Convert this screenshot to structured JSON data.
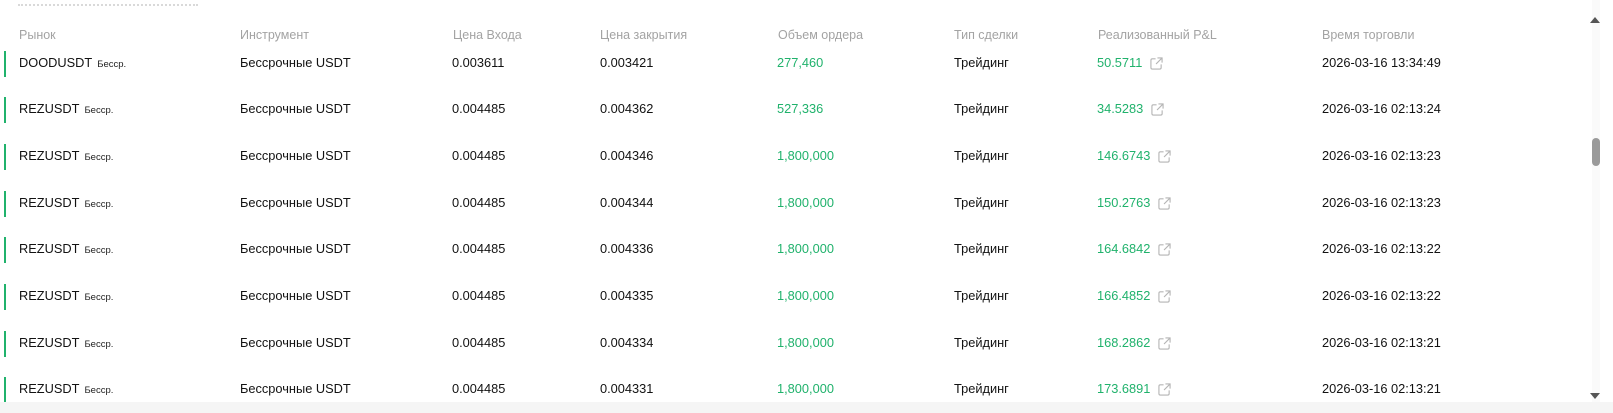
{
  "table": {
    "headers": {
      "market": "Рынок",
      "instrument": "Инструмент",
      "entry_price": "Цена Входа",
      "close_price": "Цена закрытия",
      "order_volume": "Объем ордера",
      "deal_type": "Тип сделки",
      "realized_pnl": "Реализованный P&L",
      "trade_time": "Время торговли"
    },
    "rows": [
      {
        "market": "DOODUSDT",
        "tag": "Бесср.",
        "instrument": "Бессрочные USDT",
        "entry_price": "0.003611",
        "close_price": "0.003421",
        "order_volume": "277,460",
        "deal_type": "Трейдинг",
        "realized_pnl": "50.5711",
        "trade_time": "2026-03-16 13:34:49"
      },
      {
        "market": "REZUSDT",
        "tag": "Бесср.",
        "instrument": "Бессрочные USDT",
        "entry_price": "0.004485",
        "close_price": "0.004362",
        "order_volume": "527,336",
        "deal_type": "Трейдинг",
        "realized_pnl": "34.5283",
        "trade_time": "2026-03-16 02:13:24"
      },
      {
        "market": "REZUSDT",
        "tag": "Бесср.",
        "instrument": "Бессрочные USDT",
        "entry_price": "0.004485",
        "close_price": "0.004346",
        "order_volume": "1,800,000",
        "deal_type": "Трейдинг",
        "realized_pnl": "146.6743",
        "trade_time": "2026-03-16 02:13:23"
      },
      {
        "market": "REZUSDT",
        "tag": "Бесср.",
        "instrument": "Бессрочные USDT",
        "entry_price": "0.004485",
        "close_price": "0.004344",
        "order_volume": "1,800,000",
        "deal_type": "Трейдинг",
        "realized_pnl": "150.2763",
        "trade_time": "2026-03-16 02:13:23"
      },
      {
        "market": "REZUSDT",
        "tag": "Бесср.",
        "instrument": "Бессрочные USDT",
        "entry_price": "0.004485",
        "close_price": "0.004336",
        "order_volume": "1,800,000",
        "deal_type": "Трейдинг",
        "realized_pnl": "164.6842",
        "trade_time": "2026-03-16 02:13:22"
      },
      {
        "market": "REZUSDT",
        "tag": "Бесср.",
        "instrument": "Бессрочные USDT",
        "entry_price": "0.004485",
        "close_price": "0.004335",
        "order_volume": "1,800,000",
        "deal_type": "Трейдинг",
        "realized_pnl": "166.4852",
        "trade_time": "2026-03-16 02:13:22"
      },
      {
        "market": "REZUSDT",
        "tag": "Бесср.",
        "instrument": "Бессрочные USDT",
        "entry_price": "0.004485",
        "close_price": "0.004334",
        "order_volume": "1,800,000",
        "deal_type": "Трейдинг",
        "realized_pnl": "168.2862",
        "trade_time": "2026-03-16 02:13:21"
      },
      {
        "market": "REZUSDT",
        "tag": "Бесср.",
        "instrument": "Бессрочные USDT",
        "entry_price": "0.004485",
        "close_price": "0.004331",
        "order_volume": "1,800,000",
        "deal_type": "Трейдинг",
        "realized_pnl": "173.6891",
        "trade_time": "2026-03-16 02:13:21"
      }
    ]
  },
  "colors": {
    "positive": "#20b26c",
    "header_text": "#a3a3a3",
    "body_text": "#121212"
  },
  "icons": {
    "pnl_link": "external-link-icon",
    "scroll_up": "scroll-up-arrow-icon",
    "scroll_down": "scroll-down-arrow-icon"
  }
}
